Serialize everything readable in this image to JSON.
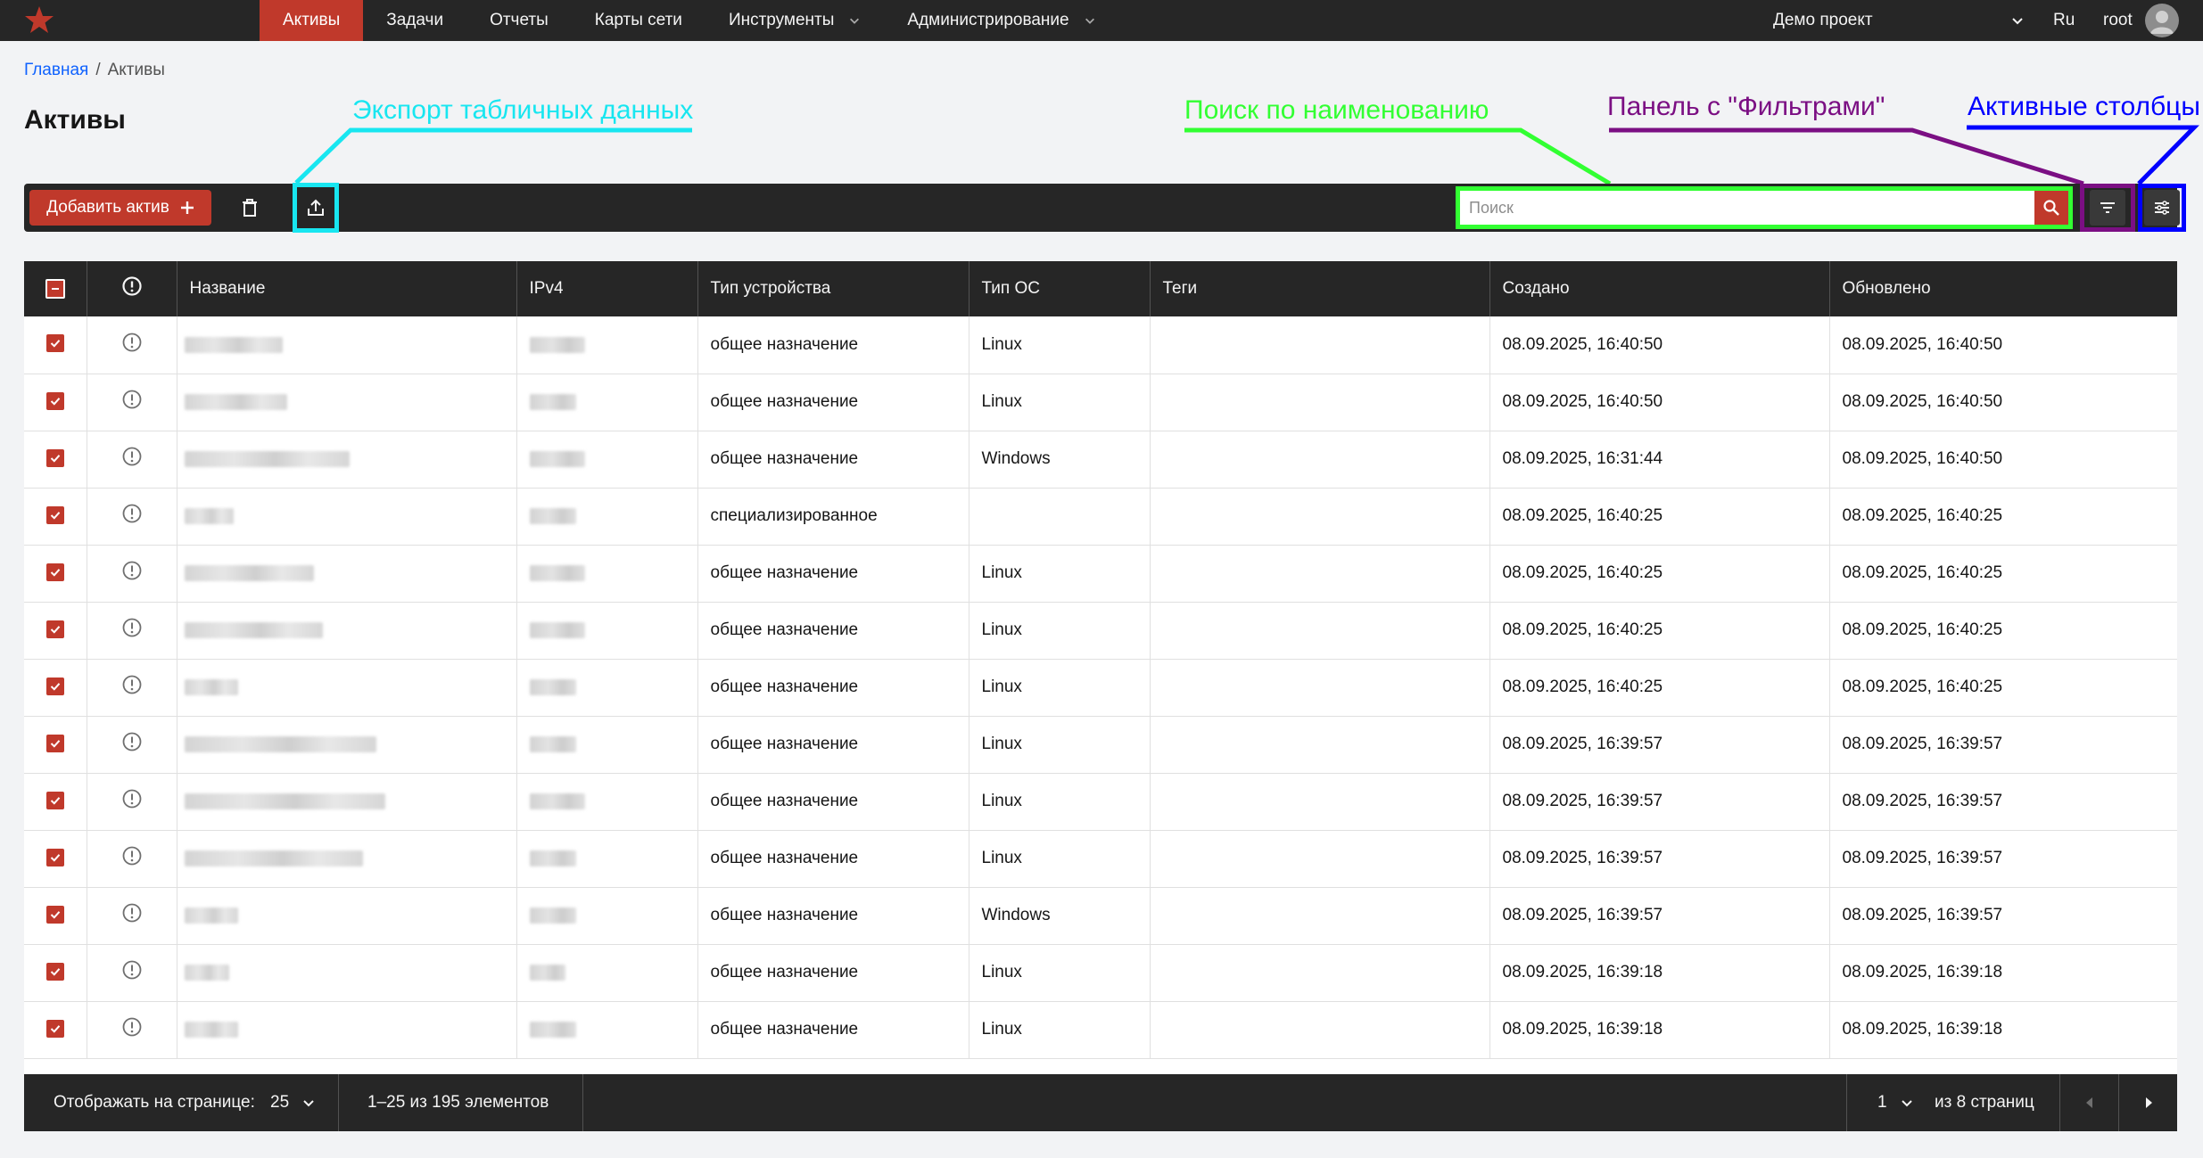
{
  "nav": {
    "items": [
      {
        "label": "Активы",
        "active": true,
        "dropdown": false
      },
      {
        "label": "Задачи",
        "active": false,
        "dropdown": false
      },
      {
        "label": "Отчеты",
        "active": false,
        "dropdown": false
      },
      {
        "label": "Карты сети",
        "active": false,
        "dropdown": false
      },
      {
        "label": "Инструменты",
        "active": false,
        "dropdown": true
      },
      {
        "label": "Администрирование",
        "active": false,
        "dropdown": true
      }
    ],
    "project": "Демо проект",
    "language": "Ru",
    "user": "root"
  },
  "breadcrumb": {
    "home": "Главная",
    "separator": "/",
    "current": "Активы"
  },
  "page_title": "Активы",
  "annotations": {
    "export": "Экспорт табличных данных",
    "search": "Поиск по наименованию",
    "filters": "Панель с \"Фильтрами\"",
    "columns": "Активные столбцы"
  },
  "toolbar": {
    "add_label": "Добавить актив",
    "search_placeholder": "Поиск"
  },
  "table": {
    "headers": [
      "Название",
      "IPv4",
      "Тип устройства",
      "Тип ОС",
      "Теги",
      "Создано",
      "Обновлено"
    ],
    "rows": [
      {
        "device": "общее назначение",
        "os": "Linux",
        "tags": "",
        "created": "08.09.2025, 16:40:50",
        "updated": "08.09.2025, 16:40:50"
      },
      {
        "device": "общее назначение",
        "os": "Linux",
        "tags": "",
        "created": "08.09.2025, 16:40:50",
        "updated": "08.09.2025, 16:40:50"
      },
      {
        "device": "общее назначение",
        "os": "Windows",
        "tags": "",
        "created": "08.09.2025, 16:31:44",
        "updated": "08.09.2025, 16:40:50"
      },
      {
        "device": "специализированное",
        "os": "",
        "tags": "",
        "created": "08.09.2025, 16:40:25",
        "updated": "08.09.2025, 16:40:25"
      },
      {
        "device": "общее назначение",
        "os": "Linux",
        "tags": "",
        "created": "08.09.2025, 16:40:25",
        "updated": "08.09.2025, 16:40:25"
      },
      {
        "device": "общее назначение",
        "os": "Linux",
        "tags": "",
        "created": "08.09.2025, 16:40:25",
        "updated": "08.09.2025, 16:40:25"
      },
      {
        "device": "общее назначение",
        "os": "Linux",
        "tags": "",
        "created": "08.09.2025, 16:40:25",
        "updated": "08.09.2025, 16:40:25"
      },
      {
        "device": "общее назначение",
        "os": "Linux",
        "tags": "",
        "created": "08.09.2025, 16:39:57",
        "updated": "08.09.2025, 16:39:57"
      },
      {
        "device": "общее назначение",
        "os": "Linux",
        "tags": "",
        "created": "08.09.2025, 16:39:57",
        "updated": "08.09.2025, 16:39:57"
      },
      {
        "device": "общее назначение",
        "os": "Linux",
        "tags": "",
        "created": "08.09.2025, 16:39:57",
        "updated": "08.09.2025, 16:39:57"
      },
      {
        "device": "общее назначение",
        "os": "Windows",
        "tags": "",
        "created": "08.09.2025, 16:39:57",
        "updated": "08.09.2025, 16:39:57"
      },
      {
        "device": "общее назначение",
        "os": "Linux",
        "tags": "",
        "created": "08.09.2025, 16:39:18",
        "updated": "08.09.2025, 16:39:18"
      },
      {
        "device": "общее назначение",
        "os": "Linux",
        "tags": "",
        "created": "08.09.2025, 16:39:18",
        "updated": "08.09.2025, 16:39:18"
      }
    ]
  },
  "pagination": {
    "per_page_label": "Отображать на странице:",
    "per_page_value": "25",
    "range_text": "1–25 из 195 элементов",
    "page_value": "1",
    "pages_text": "из 8 страниц"
  },
  "colors": {
    "accent": "#c0392b",
    "nav_bg": "#262626",
    "annotation_export": "#18e6f0",
    "annotation_search": "#32ff32",
    "annotation_filters": "#7b0f83",
    "annotation_columns": "#0000ff"
  }
}
